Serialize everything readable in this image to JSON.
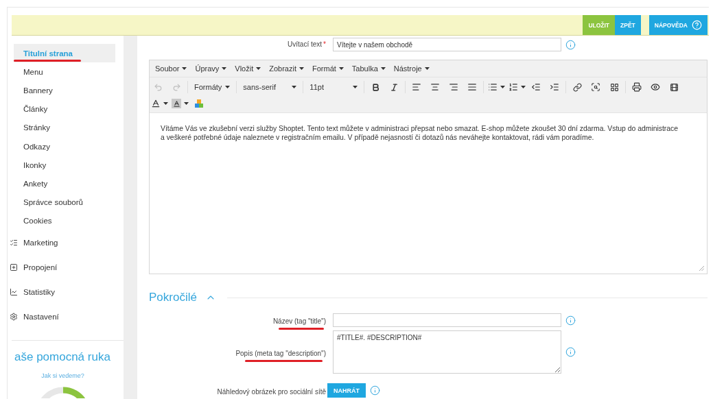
{
  "action_bar": {
    "buttons": [
      {
        "label": "ULOŽIT",
        "kind": "save"
      },
      {
        "label": "ZPĚT",
        "kind": "back"
      },
      {
        "label": "NÁPOVĚDA",
        "kind": "help"
      }
    ]
  },
  "sidebar": {
    "pages": [
      {
        "label": "Titulní strana",
        "selected": true,
        "underlined": true
      },
      {
        "label": "Menu",
        "selected": false,
        "underlined": false
      },
      {
        "label": "Bannery",
        "selected": false,
        "underlined": false
      },
      {
        "label": "Články",
        "selected": false,
        "underlined": false
      },
      {
        "label": "Stránky",
        "selected": false,
        "underlined": false
      },
      {
        "label": "Odkazy",
        "selected": false,
        "underlined": false
      },
      {
        "label": "Ikonky",
        "selected": false,
        "underlined": false
      },
      {
        "label": "Ankety",
        "selected": false,
        "underlined": false
      },
      {
        "label": "Správce souborů",
        "selected": false,
        "underlined": false
      },
      {
        "label": "Cookies",
        "selected": false,
        "underlined": false
      }
    ],
    "sections": [
      "Marketing",
      "Propojení",
      "Statistiky",
      "Nastavení"
    ],
    "help": {
      "title": "aše pomocná ruka",
      "link": "Jak si vedeme?"
    }
  },
  "welcome_field": {
    "label": "Uvítací text",
    "required_mark": "*",
    "value": "Vítejte v našem obchodě"
  },
  "editor": {
    "menu": [
      "Soubor",
      "Úpravy",
      "Vložit",
      "Zobrazit",
      "Formát",
      "Tabulka",
      "Nástroje"
    ],
    "undo": {
      "disabled": true
    },
    "redo": {
      "disabled": true
    },
    "formats": "Formáty",
    "font_family": "sans-serif",
    "font_size": "11pt",
    "content": "Vítáme Vás ve zkušební verzi služby Shoptet. Tento text můžete v administraci přepsat nebo smazat. E-shop můžete zkoušet 30 dní zdarma. Vstup do administrace a veškeré potřebné údaje naleznete v registračním emailu. V případě nejasností či dotazů nás neváhejte kontaktovat, rádi vám poradíme."
  },
  "advanced": {
    "title": "Pokročilé",
    "expanded": true,
    "fields": [
      {
        "kind": "text",
        "label": "Název (tag \"title\")",
        "underlined": true
      },
      {
        "kind": "textarea",
        "label": "Popis (meta tag \"description\")",
        "value": "#TITLE#. #DESCRIPTION#",
        "underlined": true
      },
      {
        "kind": "upload",
        "label": "Náhledový obrázek pro sociální sítě",
        "button": "NAHRÁT",
        "underlined": false
      }
    ]
  }
}
